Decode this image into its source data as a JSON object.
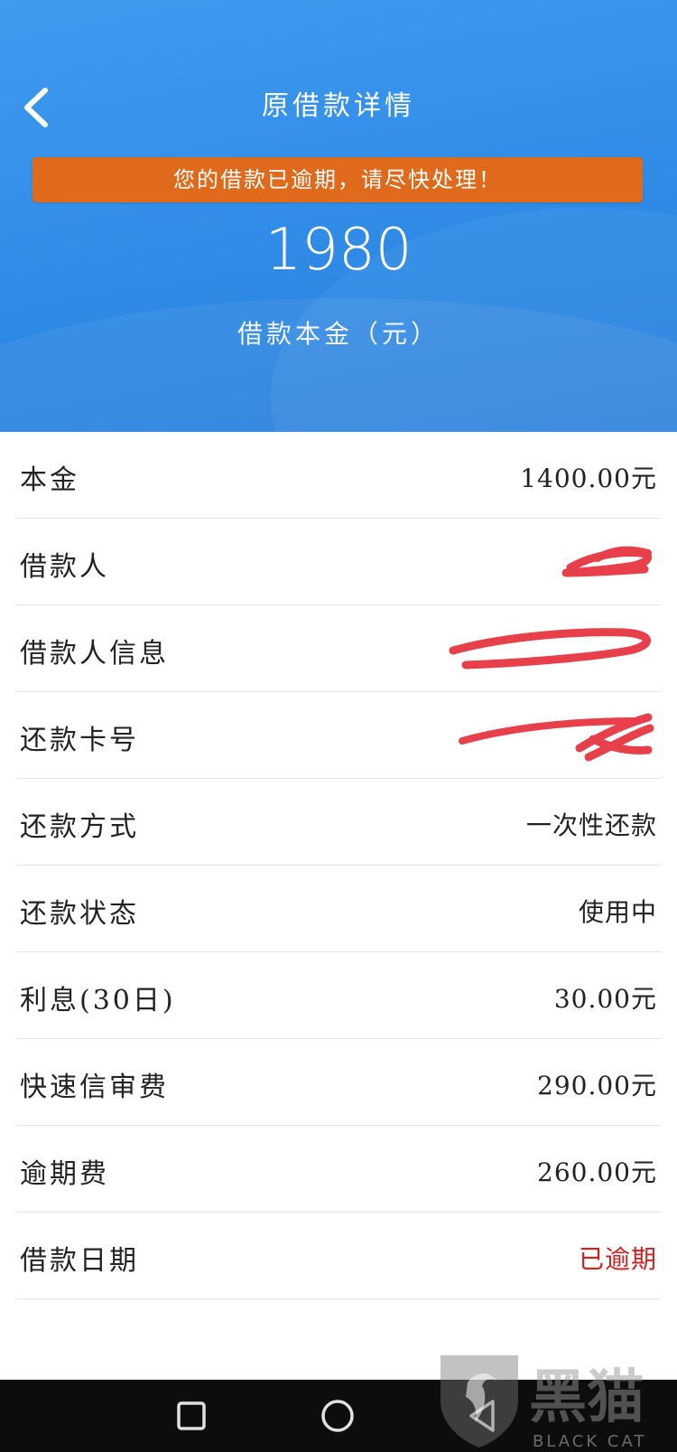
{
  "header": {
    "title": "原借款详情",
    "alert": "您的借款已逾期，请尽快处理！",
    "amount": "1980",
    "amount_label": "借款本金（元）"
  },
  "details": [
    {
      "label": "本金",
      "value": "1400.00元"
    },
    {
      "label": "借款人",
      "value": ""
    },
    {
      "label": "借款人信息",
      "value": ""
    },
    {
      "label": "还款卡号",
      "value": ""
    },
    {
      "label": "还款方式",
      "value": "一次性还款"
    },
    {
      "label": "还款状态",
      "value": "使用中"
    },
    {
      "label": "利息(30日)",
      "value": "30.00元"
    },
    {
      "label": "快速信审费",
      "value": "290.00元"
    },
    {
      "label": "逾期费",
      "value": "260.00元"
    },
    {
      "label": "借款日期",
      "value": "已逾期"
    }
  ],
  "watermark": {
    "text": "黑猫",
    "subtext": "BLACK CAT"
  },
  "colors": {
    "header_blue": "#3a95ec",
    "alert_orange": "#e06a1c",
    "overdue_red": "#d62020",
    "redaction_red": "#e8404a"
  }
}
